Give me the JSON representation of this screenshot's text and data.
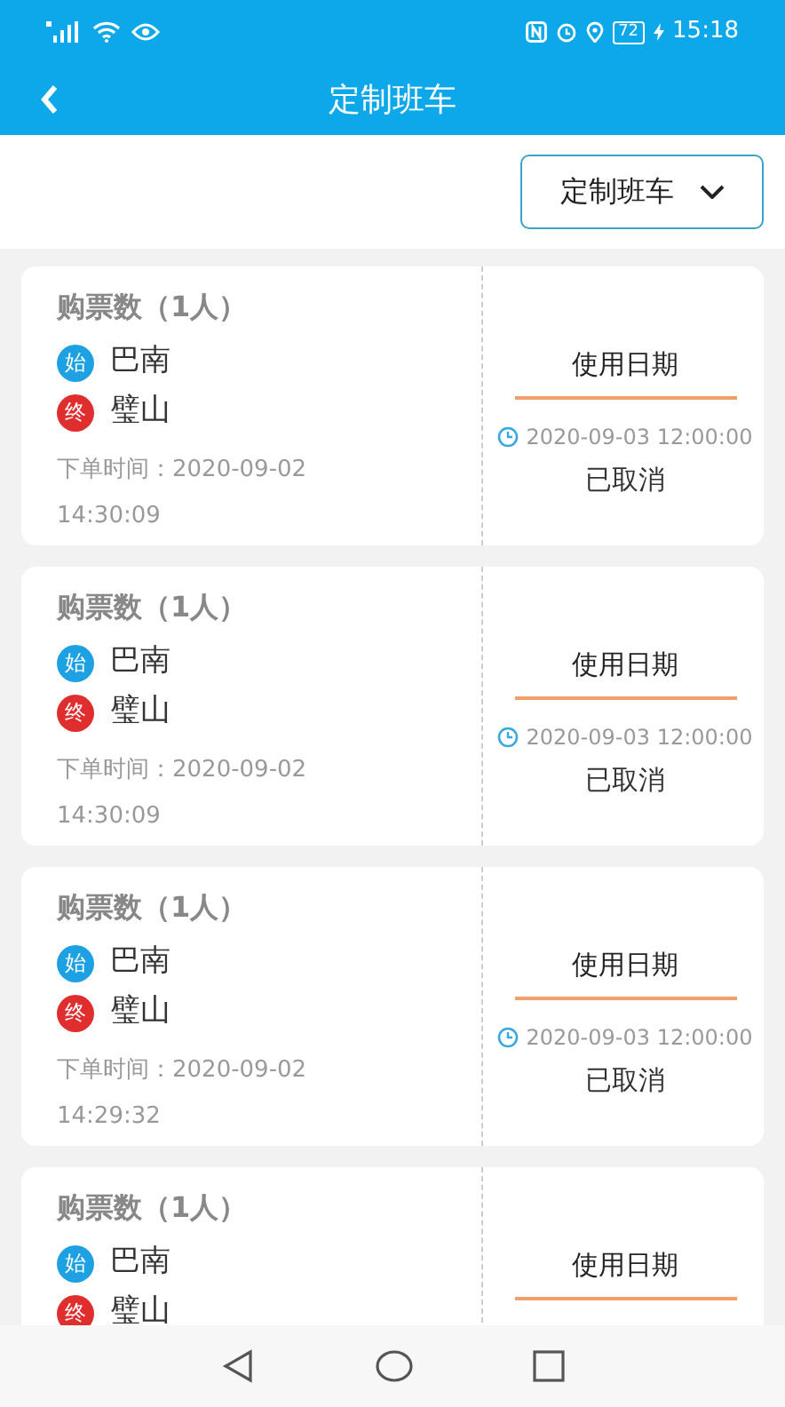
{
  "status_bar": {
    "battery": "72",
    "time": "15:18"
  },
  "header": {
    "title": "定制班车"
  },
  "filter": {
    "value": "定制班车"
  },
  "orders": [
    {
      "tickets": "购票数（1人）",
      "start_badge": "始",
      "start": "巴南",
      "end_badge": "终",
      "end": "璧山",
      "order_time": "下单时间：2020-09-02 14:30:09",
      "date_label": "使用日期",
      "date": "2020-09-03 12:00:00",
      "status": "已取消"
    },
    {
      "tickets": "购票数（1人）",
      "start_badge": "始",
      "start": "巴南",
      "end_badge": "终",
      "end": "璧山",
      "order_time": "下单时间：2020-09-02 14:30:09",
      "date_label": "使用日期",
      "date": "2020-09-03 12:00:00",
      "status": "已取消"
    },
    {
      "tickets": "购票数（1人）",
      "start_badge": "始",
      "start": "巴南",
      "end_badge": "终",
      "end": "璧山",
      "order_time": "下单时间：2020-09-02 14:29:32",
      "date_label": "使用日期",
      "date": "2020-09-03 12:00:00",
      "status": "已取消"
    },
    {
      "tickets": "购票数（1人）",
      "start_badge": "始",
      "start": "巴南",
      "end_badge": "终",
      "end": "璧山",
      "date_label": "使用日期"
    }
  ]
}
